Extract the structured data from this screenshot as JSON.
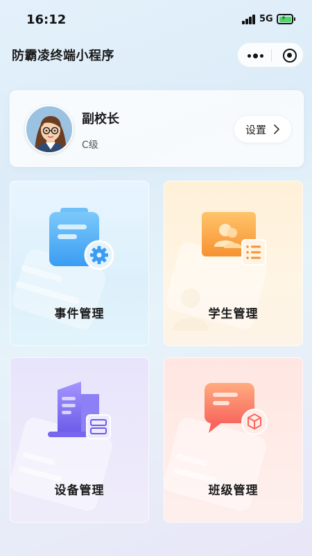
{
  "status_bar": {
    "time": "16:12",
    "network": "5G"
  },
  "nav": {
    "title": "防霸凌终端小程序"
  },
  "profile": {
    "name": "副校长",
    "level": "C级",
    "settings_label": "设置"
  },
  "menu": [
    {
      "label": "事件管理",
      "icon": "clipboard-gear-icon",
      "color": "#3fa6f5"
    },
    {
      "label": "学生管理",
      "icon": "student-card-icon",
      "color": "#f7a13a"
    },
    {
      "label": "设备管理",
      "icon": "building-server-icon",
      "color": "#7b6cf0"
    },
    {
      "label": "班级管理",
      "icon": "chat-box-icon",
      "color": "#f9776a"
    }
  ]
}
